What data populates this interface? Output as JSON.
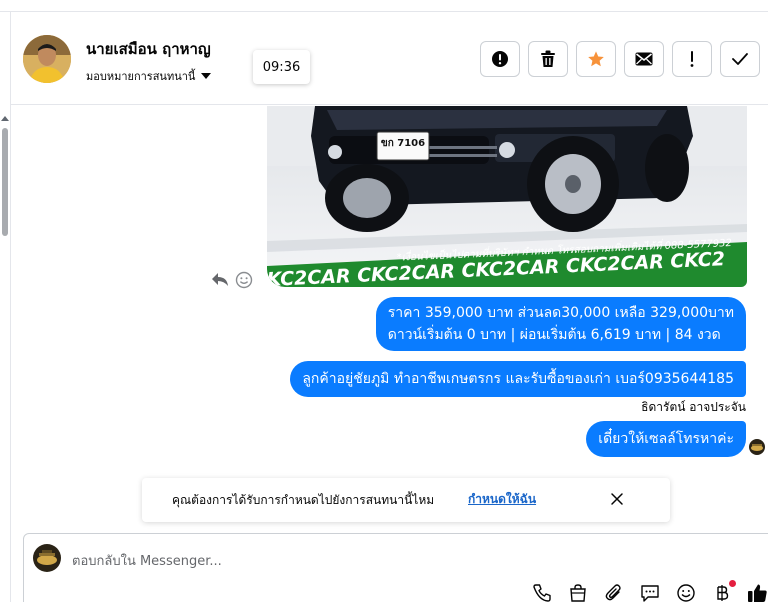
{
  "header": {
    "contact_name": "นายเสมือน ฤาหาญ",
    "assign_label": "มอบหมายการสนทนานี้",
    "time_tooltip": "09:36"
  },
  "attachment": {
    "plate": "ขก 7106",
    "disclaimer": "*เงื่อนไขเป็นไปตามที่บริษัทฯ กำหนด โทรสอบถามเพิ่มเติมได้ที่ 088-5577932",
    "banner_text": "KC2CAR CKC2CAR CKC2CAR CKC2CAR CKC2"
  },
  "messages": [
    {
      "lines": [
        "ราคา 359,000 บาท ส่วนลด30,000 เหลือ 329,000บาท",
        "ดาวน์เริ่มต้น 0 บาท | ผ่อนเริ่มต้น 6,619 บาท | 84 งวด"
      ]
    },
    {
      "text": "ลูกค้าอยู่ชัยภูมิ ทำอาชีพเกษตรกร และรับซื้อของเก่า  เบอร์0935644185"
    },
    {
      "text": "เดี๋ยวให้เซลล์โทรหาค่ะ"
    }
  ],
  "sender_name": "ธิดารัตน์ อาจประจัน",
  "banner": {
    "text": "คุณต้องการได้รับการกำหนดไปยังการสนทนานี้ไหม",
    "link": "กำหนดให้ฉัน"
  },
  "composer": {
    "placeholder": "ตอบกลับใน Messenger..."
  },
  "colors": {
    "bubble": "#0a7cff",
    "star": "#f7923a",
    "link": "#1a66c9",
    "notify_dot": "#e41e3f"
  },
  "icons": [
    "alert-circle-icon",
    "trash-icon",
    "star-icon",
    "envelope-icon",
    "exclamation-icon",
    "check-icon",
    "reply-icon",
    "emoji-icon",
    "close-icon",
    "phone-icon",
    "shopping-bag-icon",
    "paperclip-icon",
    "saved-reply-icon",
    "smiley-icon",
    "baht-icon",
    "thumbs-up-icon"
  ]
}
